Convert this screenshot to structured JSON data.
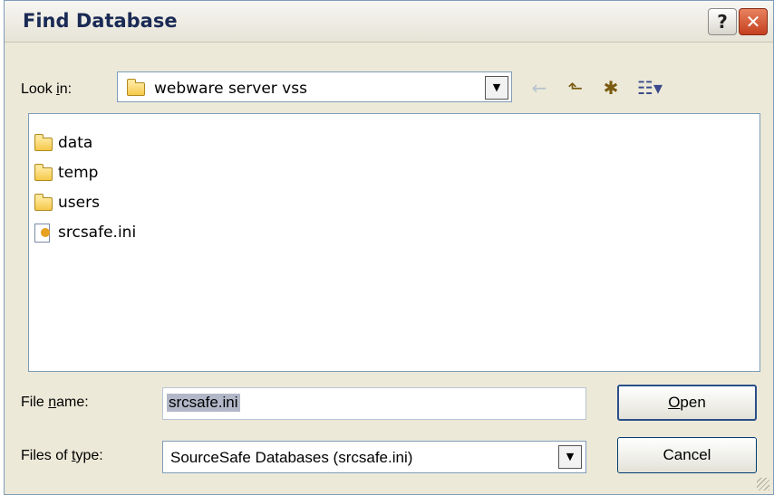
{
  "window": {
    "title": "Find Database"
  },
  "titlebar": {
    "help_label": "?",
    "close_label": "✕"
  },
  "lookin": {
    "label_prefix": "Look ",
    "label_accel": "i",
    "label_suffix": "n:",
    "value": "webware server vss"
  },
  "toolbar": {
    "back_icon": "←",
    "up_icon": "⬑",
    "new_folder_icon": "✱",
    "view_menu_icon": "☷▾"
  },
  "files": [
    {
      "name": "data",
      "icon": "folder-icon"
    },
    {
      "name": "temp",
      "icon": "folder-icon"
    },
    {
      "name": "users",
      "icon": "folder-icon"
    },
    {
      "name": "srcsafe.ini",
      "icon": "ini-file-icon"
    }
  ],
  "filename": {
    "label_prefix": "File ",
    "label_accel": "n",
    "label_suffix": "ame:",
    "value": "srcsafe.ini"
  },
  "filetype": {
    "label_prefix": "Files of ",
    "label_accel": "t",
    "label_suffix": "ype:",
    "value": "SourceSafe Databases (srcsafe.ini)"
  },
  "buttons": {
    "open_accel": "O",
    "open_rest": "pen",
    "cancel": "Cancel"
  }
}
